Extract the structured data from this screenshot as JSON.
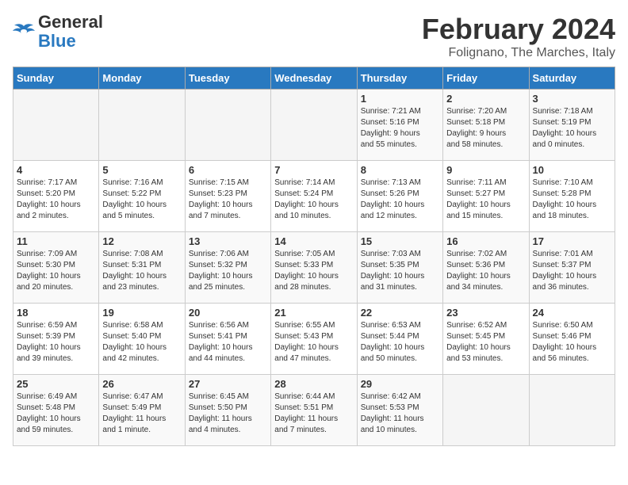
{
  "header": {
    "logo_text_general": "General",
    "logo_text_blue": "Blue",
    "main_title": "February 2024",
    "subtitle": "Folignano, The Marches, Italy"
  },
  "calendar": {
    "days_of_week": [
      "Sunday",
      "Monday",
      "Tuesday",
      "Wednesday",
      "Thursday",
      "Friday",
      "Saturday"
    ],
    "weeks": [
      [
        {
          "day": "",
          "info": ""
        },
        {
          "day": "",
          "info": ""
        },
        {
          "day": "",
          "info": ""
        },
        {
          "day": "",
          "info": ""
        },
        {
          "day": "1",
          "info": "Sunrise: 7:21 AM\nSunset: 5:16 PM\nDaylight: 9 hours\nand 55 minutes."
        },
        {
          "day": "2",
          "info": "Sunrise: 7:20 AM\nSunset: 5:18 PM\nDaylight: 9 hours\nand 58 minutes."
        },
        {
          "day": "3",
          "info": "Sunrise: 7:18 AM\nSunset: 5:19 PM\nDaylight: 10 hours\nand 0 minutes."
        }
      ],
      [
        {
          "day": "4",
          "info": "Sunrise: 7:17 AM\nSunset: 5:20 PM\nDaylight: 10 hours\nand 2 minutes."
        },
        {
          "day": "5",
          "info": "Sunrise: 7:16 AM\nSunset: 5:22 PM\nDaylight: 10 hours\nand 5 minutes."
        },
        {
          "day": "6",
          "info": "Sunrise: 7:15 AM\nSunset: 5:23 PM\nDaylight: 10 hours\nand 7 minutes."
        },
        {
          "day": "7",
          "info": "Sunrise: 7:14 AM\nSunset: 5:24 PM\nDaylight: 10 hours\nand 10 minutes."
        },
        {
          "day": "8",
          "info": "Sunrise: 7:13 AM\nSunset: 5:26 PM\nDaylight: 10 hours\nand 12 minutes."
        },
        {
          "day": "9",
          "info": "Sunrise: 7:11 AM\nSunset: 5:27 PM\nDaylight: 10 hours\nand 15 minutes."
        },
        {
          "day": "10",
          "info": "Sunrise: 7:10 AM\nSunset: 5:28 PM\nDaylight: 10 hours\nand 18 minutes."
        }
      ],
      [
        {
          "day": "11",
          "info": "Sunrise: 7:09 AM\nSunset: 5:30 PM\nDaylight: 10 hours\nand 20 minutes."
        },
        {
          "day": "12",
          "info": "Sunrise: 7:08 AM\nSunset: 5:31 PM\nDaylight: 10 hours\nand 23 minutes."
        },
        {
          "day": "13",
          "info": "Sunrise: 7:06 AM\nSunset: 5:32 PM\nDaylight: 10 hours\nand 25 minutes."
        },
        {
          "day": "14",
          "info": "Sunrise: 7:05 AM\nSunset: 5:33 PM\nDaylight: 10 hours\nand 28 minutes."
        },
        {
          "day": "15",
          "info": "Sunrise: 7:03 AM\nSunset: 5:35 PM\nDaylight: 10 hours\nand 31 minutes."
        },
        {
          "day": "16",
          "info": "Sunrise: 7:02 AM\nSunset: 5:36 PM\nDaylight: 10 hours\nand 34 minutes."
        },
        {
          "day": "17",
          "info": "Sunrise: 7:01 AM\nSunset: 5:37 PM\nDaylight: 10 hours\nand 36 minutes."
        }
      ],
      [
        {
          "day": "18",
          "info": "Sunrise: 6:59 AM\nSunset: 5:39 PM\nDaylight: 10 hours\nand 39 minutes."
        },
        {
          "day": "19",
          "info": "Sunrise: 6:58 AM\nSunset: 5:40 PM\nDaylight: 10 hours\nand 42 minutes."
        },
        {
          "day": "20",
          "info": "Sunrise: 6:56 AM\nSunset: 5:41 PM\nDaylight: 10 hours\nand 44 minutes."
        },
        {
          "day": "21",
          "info": "Sunrise: 6:55 AM\nSunset: 5:43 PM\nDaylight: 10 hours\nand 47 minutes."
        },
        {
          "day": "22",
          "info": "Sunrise: 6:53 AM\nSunset: 5:44 PM\nDaylight: 10 hours\nand 50 minutes."
        },
        {
          "day": "23",
          "info": "Sunrise: 6:52 AM\nSunset: 5:45 PM\nDaylight: 10 hours\nand 53 minutes."
        },
        {
          "day": "24",
          "info": "Sunrise: 6:50 AM\nSunset: 5:46 PM\nDaylight: 10 hours\nand 56 minutes."
        }
      ],
      [
        {
          "day": "25",
          "info": "Sunrise: 6:49 AM\nSunset: 5:48 PM\nDaylight: 10 hours\nand 59 minutes."
        },
        {
          "day": "26",
          "info": "Sunrise: 6:47 AM\nSunset: 5:49 PM\nDaylight: 11 hours\nand 1 minute."
        },
        {
          "day": "27",
          "info": "Sunrise: 6:45 AM\nSunset: 5:50 PM\nDaylight: 11 hours\nand 4 minutes."
        },
        {
          "day": "28",
          "info": "Sunrise: 6:44 AM\nSunset: 5:51 PM\nDaylight: 11 hours\nand 7 minutes."
        },
        {
          "day": "29",
          "info": "Sunrise: 6:42 AM\nSunset: 5:53 PM\nDaylight: 11 hours\nand 10 minutes."
        },
        {
          "day": "",
          "info": ""
        },
        {
          "day": "",
          "info": ""
        }
      ]
    ]
  }
}
